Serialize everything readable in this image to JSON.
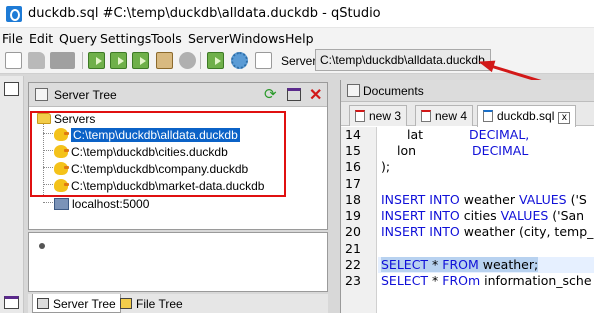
{
  "window": {
    "title": "duckdb.sql #C:\\temp\\duckdb\\alldata.duckdb - qStudio"
  },
  "menu": [
    "File",
    "Edit",
    "Query",
    "Settings",
    "Tools",
    "Server",
    "Windows",
    "Help"
  ],
  "toolbar": {
    "server_label": "Server:",
    "server_value": "C:\\temp\\duckdb\\alldata.duckdb",
    "icons": [
      "new-document-icon",
      "open-folder-icon",
      "save-icon",
      "save-all-icon",
      "run-line-icon",
      "run-selection-icon",
      "run-all-icon",
      "run-step-icon",
      "paste-icon",
      "stop-icon",
      "refresh-server-icon",
      "settings-icon",
      "export-icon"
    ]
  },
  "server_tree": {
    "title": "Server Tree",
    "root": "Servers",
    "servers": [
      "C:\\temp\\duckdb\\alldata.duckdb",
      "C:\\temp\\duckdb\\cities.duckdb",
      "C:\\temp\\duckdb\\company.duckdb",
      "C:\\temp\\duckdb\\market-data.duckdb",
      "localhost:5000"
    ],
    "selected": "C:\\temp\\duckdb\\alldata.duckdb"
  },
  "bottom_tabs": [
    "Server Tree",
    "File Tree"
  ],
  "documents": {
    "title": "Documents",
    "tabs": [
      "new 3",
      "new 4",
      "duckdb.sql"
    ],
    "active_tab": "duckdb.sql",
    "close_label": "x",
    "lines": [
      {
        "n": "14",
        "code": "lat        DECIMAL,"
      },
      {
        "n": "15",
        "code": "lon        DECIMAL"
      },
      {
        "n": "16",
        "code": ");"
      },
      {
        "n": "17",
        "code": ""
      },
      {
        "n": "18",
        "code": "INSERT INTO weather VALUES ('S"
      },
      {
        "n": "19",
        "code": "INSERT INTO cities VALUES ('San"
      },
      {
        "n": "20",
        "code": "INSERT INTO weather (city, temp_"
      },
      {
        "n": "21",
        "code": ""
      },
      {
        "n": "22",
        "code": "SELECT * FROM weather;"
      },
      {
        "n": "23",
        "code": "SELECT * FROm information_sche"
      }
    ]
  },
  "colors": {
    "highlight_box": "#e01010",
    "selection": "#0b62c7",
    "keyword": "#1010d8",
    "arrow": "#d21818"
  }
}
